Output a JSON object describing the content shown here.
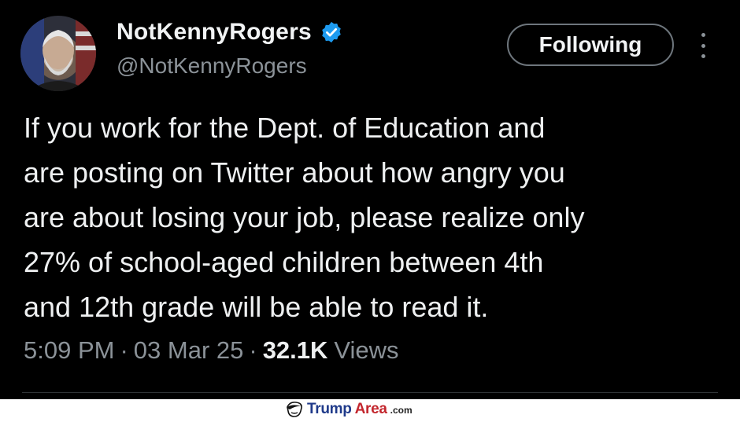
{
  "tweet": {
    "author": {
      "display_name": "NotKennyRogers",
      "handle": "@NotKennyRogers",
      "verified": true
    },
    "follow_button_label": "Following",
    "more_icon": "vertical-ellipsis-icon",
    "body_lines": [
      "If you work for the Dept. of Education and",
      "are posting on Twitter about how angry you",
      "are about losing your job, please realize only",
      "27% of school-aged children between 4th",
      "and 12th grade will be able to read it."
    ],
    "time": "5:09 PM",
    "date": "03 Mar 25",
    "separator": "·",
    "views_count": "32.1K",
    "views_label": "Views"
  },
  "watermark": {
    "part1": "Trump",
    "part2": "Area",
    "suffix": ".com"
  },
  "colors": {
    "background": "#000000",
    "text": "#e7e9ea",
    "muted": "#8b9298",
    "verified_badge": "#1d9bf0",
    "watermark_blue": "#1f3a8a",
    "watermark_red": "#c3272e"
  }
}
